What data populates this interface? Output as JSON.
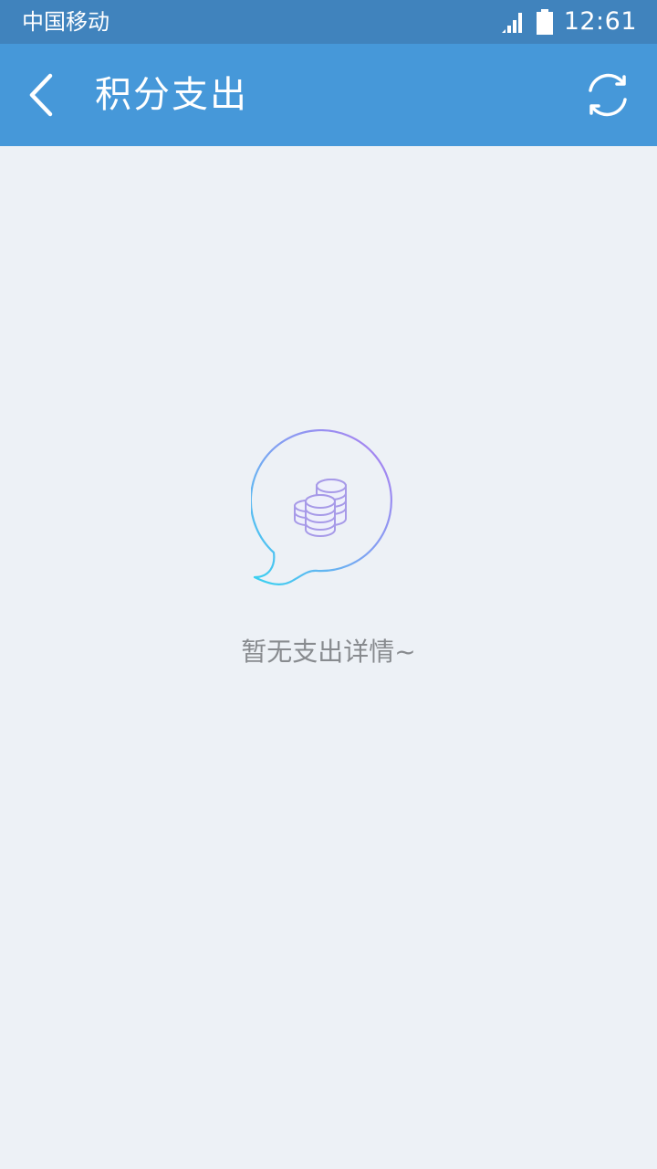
{
  "status_bar": {
    "carrier": "中国移动",
    "time": "12:61",
    "signal_icon": "signal-bars-icon",
    "battery_icon": "battery-icon"
  },
  "app_bar": {
    "title": "积分支出",
    "back_icon": "chevron-left-icon",
    "refresh_icon": "refresh-icon",
    "background_color": "#4698d9"
  },
  "empty_state": {
    "icon": "coins-speech-bubble-icon",
    "message": "暂无支出详情~"
  }
}
